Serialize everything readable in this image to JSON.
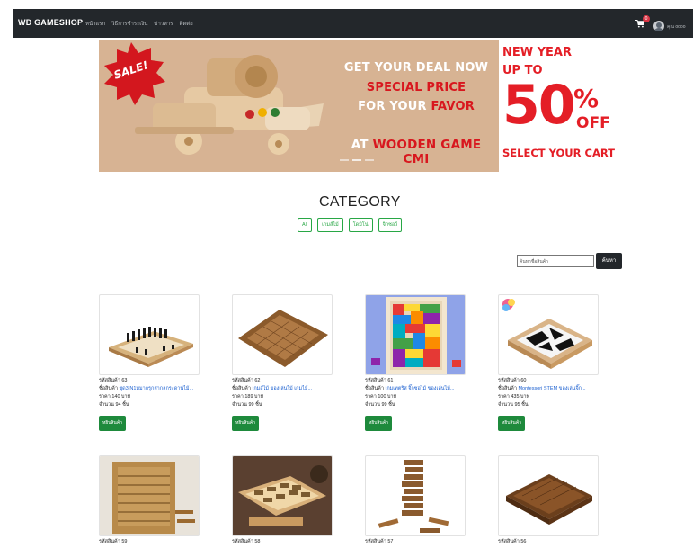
{
  "navbar": {
    "brand": "WD GAMESHOP",
    "links": [
      "หน้าแรก",
      "วิธีการชำระเงิน",
      "ข่าวสาร",
      "ติดต่อ"
    ],
    "cart_count": "0",
    "user_name": "คุณ oooo"
  },
  "banner": {
    "sale_text": "SALE!",
    "line1": "GET YOUR DEAL NOW",
    "line2": "SPECIAL PRICE",
    "line3a": "FOR YOUR ",
    "line3b": "FAVOR",
    "line4a": "AT ",
    "line4b": "WOODEN GAME CMI",
    "right_line1": "NEW YEAR",
    "right_line2": "UP TO",
    "right_big": "50",
    "right_percent": "%",
    "right_off": "OFF",
    "right_bottom": "SELECT YOUR CART"
  },
  "category": {
    "title": "CATEGORY",
    "filters": [
      "All",
      "เกมส์ไม้",
      "โดมิโน่",
      "จิกซอว์"
    ]
  },
  "search": {
    "placeholder": "ค้นหาชื่อสินค้า",
    "button": "ค้นหา"
  },
  "products": [
    {
      "code": "รหัสสินค้า 63",
      "name_label": "ชื่อสินค้า ",
      "name": "ชุด3IN1หมากรุกสากลกระดานไม้...",
      "price": "ราคา 140 บาท",
      "stock": "จำนวน 94 ชิ้น",
      "button": "หยิบสินค้า"
    },
    {
      "code": "รหัสสินค้า 62",
      "name_label": "ชื่อสินค้า ",
      "name": "เกมส์ไม้ ของเล่นไม้ เกมไม้...",
      "price": "ราคา 189 บาท",
      "stock": "จำนวน 99 ชิ้น",
      "button": "หยิบสินค้า"
    },
    {
      "code": "รหัสสินค้า 61",
      "name_label": "ชื่อสินค้า ",
      "name": "เกมเทตริส จิ๊กซอไม้ ของเล่นไม้...",
      "price": "ราคา 100 บาท",
      "stock": "จำนวน 99 ชิ้น",
      "button": "หยิบสินค้า"
    },
    {
      "code": "รหัสสินค้า 60",
      "name_label": "ชื่อสินค้า ",
      "name": "Montessori STEM ของเล่นจิ๊ก...",
      "price": "ราคา 435 บาท",
      "stock": "จำนวน 95 ชิ้น",
      "button": "หยิบสินค้า"
    },
    {
      "code": "รหัสสินค้า 59"
    },
    {
      "code": "รหัสสินค้า 58"
    },
    {
      "code": "รหัสสินค้า 57"
    },
    {
      "code": "รหัสสินค้า 56"
    }
  ]
}
